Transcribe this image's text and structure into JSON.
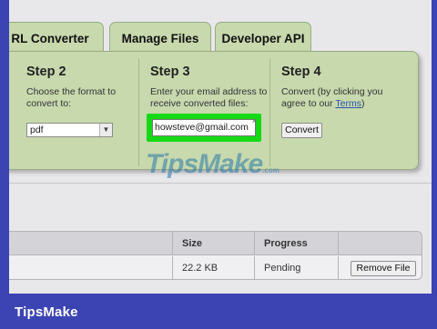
{
  "tabs": [
    {
      "label": "RL Converter"
    },
    {
      "label": "Manage Files"
    },
    {
      "label": "Developer API"
    }
  ],
  "steps": {
    "step2": {
      "title": "Step 2",
      "text": "Choose the format to convert to:",
      "format_value": "pdf"
    },
    "step3": {
      "title": "Step 3",
      "text": "Enter your email address to receive converted files:",
      "email_value": "howsteve@gmail.com",
      "clear_glyph": "×"
    },
    "step4": {
      "title": "Step 4",
      "text_before": "Convert (by clicking you agree to our ",
      "terms_link": "Terms",
      "text_after": ")",
      "button_label": "Convert"
    }
  },
  "watermark": {
    "text": "TipsMake",
    "suffix": ".com"
  },
  "table": {
    "headers": [
      "",
      "Size",
      "Progress",
      ""
    ],
    "rows": [
      {
        "name": "",
        "size": "22.2 KB",
        "progress": "Pending",
        "action_label": "Remove File"
      }
    ]
  },
  "footer": {
    "brand": "TipsMake"
  },
  "colors": {
    "accent_green": "#16d916",
    "panel_bg": "#c7d9ad",
    "border_blue": "#3c44b4"
  }
}
